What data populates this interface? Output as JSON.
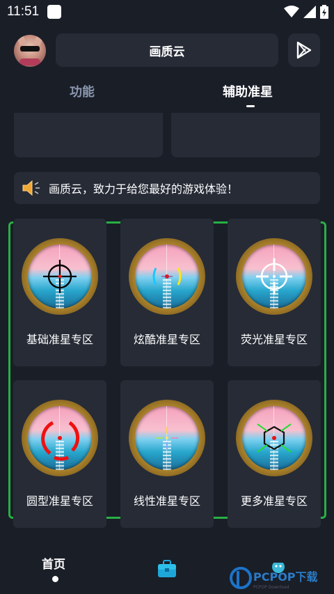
{
  "status": {
    "time": "11:51"
  },
  "header": {
    "title": "画质云"
  },
  "tabs": [
    {
      "label": "功能"
    },
    {
      "label": "辅助准星"
    }
  ],
  "notice": {
    "text": "画质云，致力于给您最好的游戏体验！"
  },
  "cards": [
    {
      "label": "基础准星专区",
      "reticle": "crosshair"
    },
    {
      "label": "炫酷准星专区",
      "reticle": "brackets"
    },
    {
      "label": "荧光准星专区",
      "reticle": "white-circle"
    },
    {
      "label": "圆型准星专区",
      "reticle": "red-circle"
    },
    {
      "label": "线性准星专区",
      "reticle": "lines"
    },
    {
      "label": "更多准星专区",
      "reticle": "hexagon"
    }
  ],
  "nav": {
    "home_label": "首页"
  },
  "watermark": {
    "text": "PCPOP下载",
    "sub": "PCPOP Download"
  },
  "colors": {
    "background": "#1a1e27",
    "card": "#262b36",
    "highlight": "#27b045",
    "tab_inactive": "#8a97ae"
  }
}
